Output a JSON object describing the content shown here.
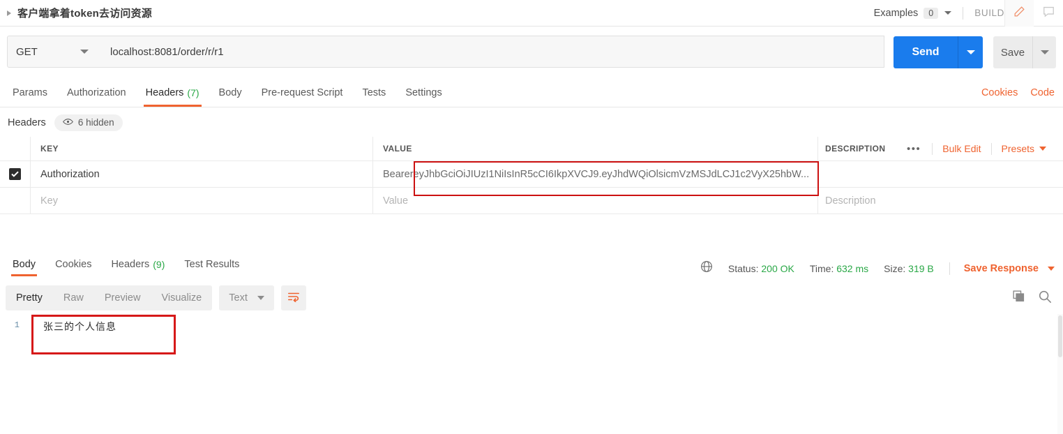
{
  "topbar": {
    "request_title": "客户端拿着token去访问资源",
    "examples_label": "Examples",
    "examples_count": "0",
    "build_label": "BUILD",
    "edit_icon": "pencil-icon",
    "comment_icon": "comment-icon"
  },
  "url_row": {
    "method": "GET",
    "url": "localhost:8081/order/r/r1",
    "send_label": "Send",
    "save_label": "Save"
  },
  "request_tabs": {
    "items": [
      {
        "label": "Params",
        "badge": "",
        "active": false
      },
      {
        "label": "Authorization",
        "badge": "",
        "active": false
      },
      {
        "label": "Headers",
        "badge": "(7)",
        "active": true
      },
      {
        "label": "Body",
        "badge": "",
        "active": false
      },
      {
        "label": "Pre-request Script",
        "badge": "",
        "active": false
      },
      {
        "label": "Tests",
        "badge": "",
        "active": false
      },
      {
        "label": "Settings",
        "badge": "",
        "active": false
      }
    ],
    "cookies_label": "Cookies",
    "code_label": "Code"
  },
  "headers_bar": {
    "title": "Headers",
    "hidden_label": "6 hidden",
    "eye_icon": "eye-icon"
  },
  "headers_table": {
    "columns": [
      "KEY",
      "VALUE",
      "DESCRIPTION"
    ],
    "more_icon": "ellipsis-icon",
    "bulk_edit_label": "Bulk Edit",
    "presets_label": "Presets",
    "rows": [
      {
        "checked": true,
        "key": "Authorization",
        "value_prefix": "Bearer ",
        "value": "eyJhbGciOiJIUzI1NiIsInR5cCI6IkpXVCJ9.eyJhdWQiOlsicmVzMSJdLCJ1c2VyX25hbW...",
        "description": ""
      }
    ],
    "placeholder_row": {
      "key": "Key",
      "value": "Value",
      "description": "Description"
    }
  },
  "response": {
    "tabs": [
      {
        "label": "Body",
        "badge": "",
        "active": true
      },
      {
        "label": "Cookies",
        "badge": "",
        "active": false
      },
      {
        "label": "Headers",
        "badge": "(9)",
        "active": false
      },
      {
        "label": "Test Results",
        "badge": "",
        "active": false
      }
    ],
    "globe_icon": "globe-icon",
    "status_label": "Status:",
    "status_value": "200 OK",
    "time_label": "Time:",
    "time_value": "632 ms",
    "size_label": "Size:",
    "size_value": "319 B",
    "save_response_label": "Save Response",
    "status_color": "#2aa847"
  },
  "body_toolbar": {
    "formats": [
      {
        "label": "Pretty",
        "active": true
      },
      {
        "label": "Raw",
        "active": false
      },
      {
        "label": "Preview",
        "active": false
      },
      {
        "label": "Visualize",
        "active": false
      }
    ],
    "type_label": "Text",
    "wrap_icon": "word-wrap-icon",
    "copy_icon": "copy-icon",
    "search_icon": "search-icon"
  },
  "body_viewer": {
    "line_numbers": [
      "1"
    ],
    "lines": [
      "张三的个人信息"
    ]
  },
  "colors": {
    "accent_orange": "#ef6330",
    "send_blue": "#1a7ced",
    "success_green": "#2aa847",
    "annotation_red": "#cc1111"
  }
}
